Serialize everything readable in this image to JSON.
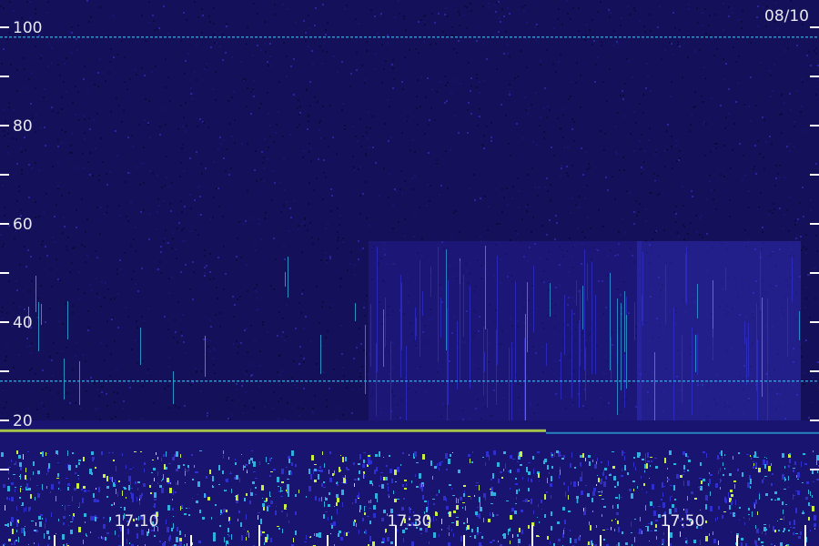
{
  "chart_data": {
    "type": "heatmap",
    "date_label": "08/10",
    "x_tick_labels": [
      "17:10",
      "17:30",
      "17:50"
    ],
    "x_major_ticks": [
      "17:10",
      "17:30",
      "17:50"
    ],
    "x_range": [
      "17:02",
      "18:02"
    ],
    "x_minor_tick_minutes": 5,
    "y_tick_labels": [
      "20",
      "40",
      "60",
      "80",
      "100"
    ],
    "y_range": [
      0,
      103
    ],
    "y_minor_ticks": [
      10,
      30,
      50,
      70,
      90
    ],
    "persistent_lines_y": [
      98,
      28,
      18
    ],
    "colors": {
      "background": "#14105a",
      "low": "#1a1470",
      "mid": "#2f2fd0",
      "high": "#30b0e0",
      "peak": "#c8f040"
    }
  }
}
